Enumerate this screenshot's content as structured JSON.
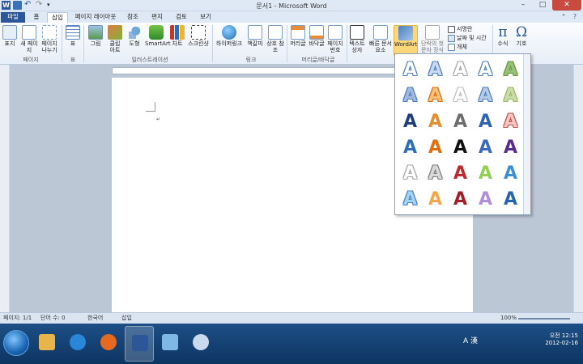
{
  "window": {
    "title": "문서1 - Microsoft Word",
    "app_icon_label": "W"
  },
  "tabs": [
    {
      "label": "파일"
    },
    {
      "label": "홈"
    },
    {
      "label": "삽입"
    },
    {
      "label": "페이지 레이아웃"
    },
    {
      "label": "참조"
    },
    {
      "label": "편지"
    },
    {
      "label": "검토"
    },
    {
      "label": "보기"
    }
  ],
  "ribbon": {
    "pages_group": {
      "cover_label": "표지",
      "new_page_label": "새 페이지",
      "page_break_label": "페이지 나누기",
      "group_label": "페이지"
    },
    "table_group": {
      "table_label": "표",
      "group_label": "표"
    },
    "illustrations_group": {
      "picture_label": "그림",
      "clipart_label": "클립 아트",
      "shapes_label": "도형",
      "smartart_label": "SmartArt",
      "chart_label": "차트",
      "screenshot_label": "스크린샷",
      "group_label": "일러스트레이션"
    },
    "links_group": {
      "hyperlink_label": "하이퍼링크",
      "bookmark_label": "책갈피",
      "cross_ref_label": "상호 참조",
      "group_label": "링크"
    },
    "header_footer_group": {
      "header_label": "머리글",
      "footer_label": "바닥글",
      "page_number_label": "페이지 번호",
      "group_label": "머리글/바닥글"
    },
    "text_group": {
      "textbox_label": "텍스트 상자",
      "quickparts_label": "빠른 문서 요소",
      "wordart_label": "WordArt",
      "dropcap_label": "단락의 첫 문자 장식",
      "signature_label": "서명란",
      "datetime_label": "날짜 및 시간",
      "object_label": "개체"
    },
    "symbols_group": {
      "equation_label": "수식",
      "symbol_label": "기호",
      "equation_glyph": "π",
      "symbol_glyph": "Ω"
    }
  },
  "wordart_gallery": {
    "glyph": "A",
    "styles": [
      "#ffffff",
      "#c9d9f0",
      "#ffffff",
      "#ffffff",
      "#92c47a",
      "#9fb9e3",
      "#f4c27d",
      "#ffffff",
      "#b8cbe8",
      "#c9dcae",
      "#1f3f7a",
      "#e38d2c",
      "#6d6d6d",
      "#2f63b1",
      "#f7c8c0",
      "#2f6db7",
      "#e46c0a",
      "#111111",
      "#3b6ac0",
      "#5b2c8f",
      "#ffffff",
      "#d9d9d9",
      "#c0282d",
      "#92d050",
      "#3a8fd6",
      "#9fd4f4",
      "#f6a54b",
      "#a31d24",
      "#b48fd9",
      "#2464b0"
    ],
    "outline_colors": [
      "#4f81bd",
      "#4f81bd",
      "#a6a6a6",
      "#4f81bd",
      "#76923c",
      "#4f81bd",
      "#e46c0a",
      "#bfbfbf",
      "#4f81bd",
      "#9bbb59",
      "#ffffff",
      "#ffffff",
      "#ffffff",
      "#ffffff",
      "#c0504d",
      "#ffffff",
      "#ffffff",
      "#ffffff",
      "#ffffff",
      "#ffffff",
      "#a6a6a6",
      "#7f7f7f",
      "#ffffff",
      "#ffffff",
      "#ffffff",
      "#4f81bd",
      "#ffffff",
      "#ffffff",
      "#ffffff",
      "#ffffff"
    ]
  },
  "statusbar": {
    "page": "페이지: 1/1",
    "words": "단어 수: 0",
    "language": "한국어",
    "mode": "삽입",
    "zoom": "100%"
  },
  "tray": {
    "time": "오전 12:15",
    "date": "2012-02-16",
    "ime": "A 漢"
  },
  "colors": {
    "accent": "#2b579a",
    "highlight": "#fbd779"
  }
}
